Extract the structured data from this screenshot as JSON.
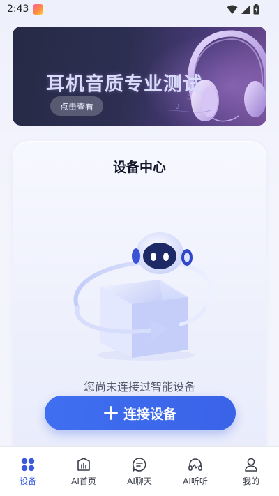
{
  "status_bar": {
    "time": "2:43"
  },
  "banner": {
    "title": "耳机音质专业测试",
    "button_label": "点击查看"
  },
  "device_card": {
    "title": "设备中心",
    "empty_text": "您尚未连接过智能设备",
    "connect_label": "连接设备"
  },
  "bottom_nav": {
    "items": [
      {
        "label": "设备",
        "icon": "grid-icon",
        "active": true
      },
      {
        "label": "AI首页",
        "icon": "chart-icon",
        "active": false
      },
      {
        "label": "AI聊天",
        "icon": "chat-icon",
        "active": false
      },
      {
        "label": "AI听听",
        "icon": "headphone-icon",
        "active": false
      },
      {
        "label": "我的",
        "icon": "user-icon",
        "active": false
      }
    ]
  },
  "colors": {
    "accent": "#3b5bdb",
    "button": "#3f6ff0",
    "banner_bg": "#2d2f52"
  }
}
